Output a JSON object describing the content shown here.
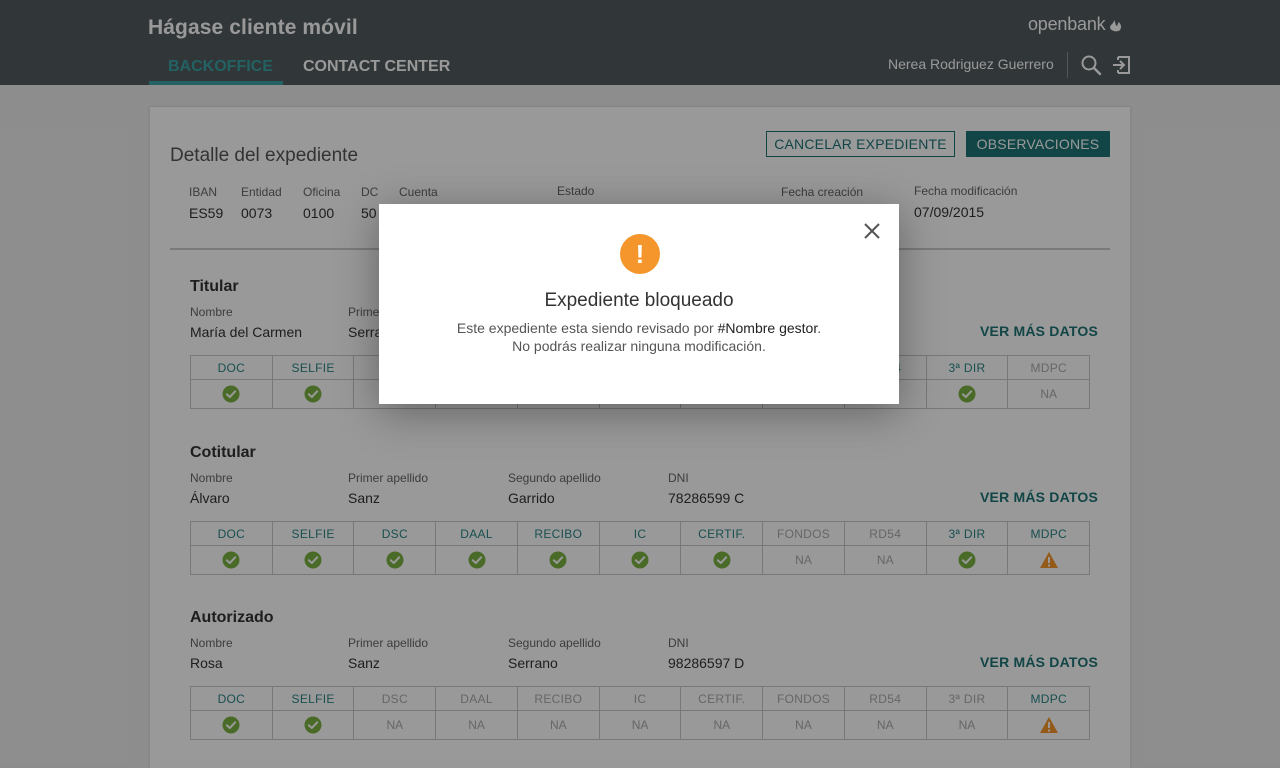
{
  "header": {
    "app_title": "Hágase cliente móvil",
    "tabs": [
      {
        "label": "BACKOFFICE",
        "active": true
      },
      {
        "label": "CONTACT CENTER",
        "active": false
      }
    ],
    "logo_text": "openbank",
    "user_name": "Nerea Rodriguez Guerrero",
    "icons": [
      "search-icon",
      "logout-icon"
    ]
  },
  "detail": {
    "title": "Detalle del expediente",
    "cancel_button": "CANCELAR EXPEDIENTE",
    "observations_button": "OBSERVACIONES",
    "fields": {
      "iban_label": "IBAN",
      "iban": "ES59",
      "entidad_label": "Entidad",
      "entidad": "0073",
      "oficina_label": "Oficina",
      "oficina": "0100",
      "dc_label": "DC",
      "dc": "50",
      "cuenta_label": "Cuenta",
      "estado_label": "Estado",
      "fecha_creacion_label": "Fecha creación",
      "fecha_modificacion_label": "Fecha modificación",
      "fecha_modificacion": "07/09/2015"
    }
  },
  "doc_columns": [
    "DOC",
    "SELFIE",
    "DSC",
    "DAAL",
    "RECIBO",
    "IC",
    "CERTIF.",
    "FONDOS",
    "RD54",
    "3ª DIR",
    "MDPC"
  ],
  "na_text": "NA",
  "more_label": "VER MÁS DATOS",
  "sections": [
    {
      "title": "Titular",
      "labels": [
        "Nombre",
        "Primer apellido",
        "Segundo apellido",
        "DNI"
      ],
      "values": [
        "María del Carmen",
        "Serrano",
        "",
        ""
      ],
      "status": [
        "ok",
        "ok",
        "ok",
        "ok",
        "ok",
        "ok",
        "ok",
        "ok",
        "ok",
        "ok",
        "na"
      ],
      "inactive_heads": [
        false,
        false,
        false,
        false,
        false,
        false,
        false,
        false,
        false,
        false,
        true
      ]
    },
    {
      "title": "Cotitular",
      "labels": [
        "Nombre",
        "Primer apellido",
        "Segundo apellido",
        "DNI"
      ],
      "values": [
        "Álvaro",
        "Sanz",
        "Garrido",
        "78286599 C"
      ],
      "status": [
        "ok",
        "ok",
        "ok",
        "ok",
        "ok",
        "ok",
        "ok",
        "na",
        "na",
        "ok",
        "warn"
      ],
      "inactive_heads": [
        false,
        false,
        false,
        false,
        false,
        false,
        false,
        true,
        true,
        false,
        false
      ]
    },
    {
      "title": "Autorizado",
      "labels": [
        "Nombre",
        "Primer apellido",
        "Segundo apellido",
        "DNI"
      ],
      "values": [
        "Rosa",
        "Sanz",
        "Serrano",
        "98286597 D"
      ],
      "status": [
        "ok",
        "ok",
        "na",
        "na",
        "na",
        "na",
        "na",
        "na",
        "na",
        "na",
        "warn"
      ],
      "inactive_heads": [
        false,
        false,
        true,
        true,
        true,
        true,
        true,
        true,
        true,
        true,
        false
      ]
    }
  ],
  "modal": {
    "title": "Expediente bloqueado",
    "line1_prefix": "Este expediente esta siendo revisado por ",
    "line1_name": "#Nombre gestor",
    "line1_suffix": ".",
    "line2": "No podrás realizar ninguna modificación."
  },
  "colors": {
    "header_bg": "#525b5e",
    "accent": "#3aa3a5",
    "primary": "#1e7476",
    "ok_green": "#7cb342",
    "warn_orange": "#f5962c"
  }
}
